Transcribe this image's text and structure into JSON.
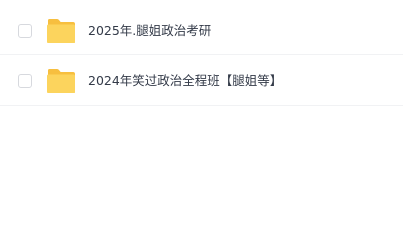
{
  "file_list": {
    "items": [
      {
        "name": "2025年.腿姐政治考研",
        "type_icon": "folder-icon",
        "checked": false
      },
      {
        "name": "2024年笑过政治全程班【腿姐等】",
        "type_icon": "folder-icon",
        "checked": false
      }
    ]
  },
  "colors": {
    "folder_back": "#f7bf3f",
    "folder_front": "#fcd45d",
    "text": "#333a48",
    "checkbox_border": "#d7d9de",
    "row_divider": "#f1f2f4"
  }
}
